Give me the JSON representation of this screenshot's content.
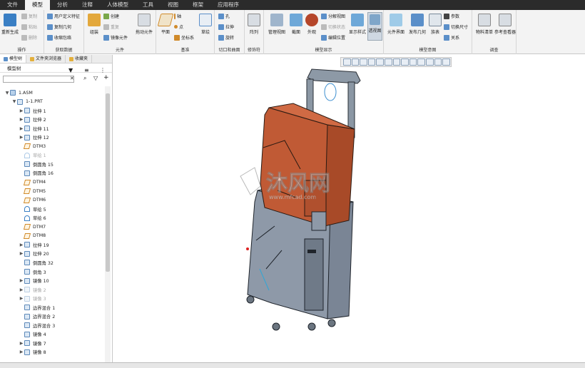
{
  "tabs": [
    "文件",
    "模型",
    "分析",
    "注释",
    "人体模型",
    "工具",
    "视图",
    "框架",
    "应用程序"
  ],
  "active_tab": 1,
  "ribbon": {
    "ops": {
      "regen": "重新生成",
      "copy": "复制",
      "paste": "粘贴",
      "delete": "删除",
      "label": "操作"
    },
    "getdata": {
      "udf": "用户定义特征",
      "copygeom": "复制几何",
      "shrink": "收缩包络",
      "label": "获取数据"
    },
    "component": {
      "assemble": "组装",
      "create": "创建",
      "repeat": "重复",
      "mirror": "镜像元件",
      "drag": "拖动元件",
      "label": "元件"
    },
    "datum": {
      "plane": "平面",
      "axis": "轴",
      "point": "点",
      "csys": "坐标系",
      "sketch": "草绘",
      "label": "基准"
    },
    "cut": {
      "hole": "孔",
      "extrude": "拉伸",
      "revolve": "旋转",
      "label": "切口和曲面"
    },
    "modifiers": {
      "pattern": "阵列",
      "label": "修饰符"
    },
    "display": {
      "manage": "管理视图",
      "section": "截面",
      "appearance": "外观",
      "explode": "分解视图",
      "toggle_explode": "切换状态",
      "edit_pos": "编辑位置",
      "display_style": "显示样式",
      "perspective": "透视图",
      "label": "模型显示"
    },
    "intent": {
      "interface": "元件界面",
      "publish": "发布几何",
      "table": "族表",
      "params": "参数",
      "switch_dim": "切换尺寸",
      "relations": "关系",
      "label": "模型意图"
    },
    "investigate": {
      "bom": "物料清单",
      "refviewer": "参考查看器",
      "label": "调查"
    }
  },
  "nav_tabs": [
    "模型树",
    "文件夹浏览器",
    "收藏夹"
  ],
  "tree_header": "模型树",
  "search_placeholder": "",
  "tree": [
    {
      "label": "1.ASM",
      "level": 0,
      "arrow": "▼",
      "type": "asm",
      "dim": false
    },
    {
      "label": "1-1.PRT",
      "level": 1,
      "arrow": "▼",
      "type": "prt",
      "dim": false
    },
    {
      "label": "拉伸 1",
      "level": 2,
      "arrow": "▶",
      "type": "feat",
      "dim": false
    },
    {
      "label": "拉伸 2",
      "level": 2,
      "arrow": "▶",
      "type": "feat",
      "dim": false
    },
    {
      "label": "拉伸 11",
      "level": 2,
      "arrow": "▶",
      "type": "feat",
      "dim": false
    },
    {
      "label": "拉伸 12",
      "level": 2,
      "arrow": "▶",
      "type": "feat",
      "dim": false
    },
    {
      "label": "DTM3",
      "level": 2,
      "arrow": "",
      "type": "datum",
      "dim": false
    },
    {
      "label": "草绘 1",
      "level": 2,
      "arrow": "",
      "type": "sketch",
      "dim": true
    },
    {
      "label": "倒圆角 15",
      "level": 2,
      "arrow": "",
      "type": "feat",
      "dim": false
    },
    {
      "label": "倒圆角 16",
      "level": 2,
      "arrow": "",
      "type": "feat",
      "dim": false
    },
    {
      "label": "DTM4",
      "level": 2,
      "arrow": "",
      "type": "datum",
      "dim": false
    },
    {
      "label": "DTM5",
      "level": 2,
      "arrow": "",
      "type": "datum",
      "dim": false
    },
    {
      "label": "DTM6",
      "level": 2,
      "arrow": "",
      "type": "datum",
      "dim": false
    },
    {
      "label": "草绘 5",
      "level": 2,
      "arrow": "",
      "type": "sketch",
      "dim": false
    },
    {
      "label": "草绘 6",
      "level": 2,
      "arrow": "",
      "type": "sketch",
      "dim": false
    },
    {
      "label": "DTM7",
      "level": 2,
      "arrow": "",
      "type": "datum",
      "dim": false
    },
    {
      "label": "DTM8",
      "level": 2,
      "arrow": "",
      "type": "datum",
      "dim": false
    },
    {
      "label": "拉伸 19",
      "level": 2,
      "arrow": "▶",
      "type": "feat",
      "dim": false
    },
    {
      "label": "拉伸 20",
      "level": 2,
      "arrow": "▶",
      "type": "feat",
      "dim": false
    },
    {
      "label": "倒圆角 32",
      "level": 2,
      "arrow": "",
      "type": "feat",
      "dim": false
    },
    {
      "label": "倒角 3",
      "level": 2,
      "arrow": "",
      "type": "feat",
      "dim": false
    },
    {
      "label": "镜像 10",
      "level": 2,
      "arrow": "▶",
      "type": "feat",
      "dim": false
    },
    {
      "label": "镜像 2",
      "level": 2,
      "arrow": "▶",
      "type": "feat",
      "dim": true
    },
    {
      "label": "镜像 3",
      "level": 2,
      "arrow": "▶",
      "type": "feat",
      "dim": true
    },
    {
      "label": "边界混合 1",
      "level": 2,
      "arrow": "",
      "type": "feat",
      "dim": false
    },
    {
      "label": "边界混合 2",
      "level": 2,
      "arrow": "",
      "type": "feat",
      "dim": false
    },
    {
      "label": "边界混合 3",
      "level": 2,
      "arrow": "",
      "type": "feat",
      "dim": false
    },
    {
      "label": "镜像 4",
      "level": 2,
      "arrow": "",
      "type": "feat",
      "dim": false
    },
    {
      "label": "镜像 7",
      "level": 2,
      "arrow": "▶",
      "type": "feat",
      "dim": false
    },
    {
      "label": "镜像 8",
      "level": 2,
      "arrow": "▶",
      "type": "feat",
      "dim": false
    }
  ],
  "watermark": {
    "name": "沐风网",
    "url": "www.mfcad.com"
  },
  "colors": {
    "upper_case": "#c05a35",
    "lower_case": "#8e99a8",
    "handle": "#8d99a6",
    "ribbon_bg": "#f3f3f3",
    "tabbar_bg": "#2b2b2b"
  }
}
